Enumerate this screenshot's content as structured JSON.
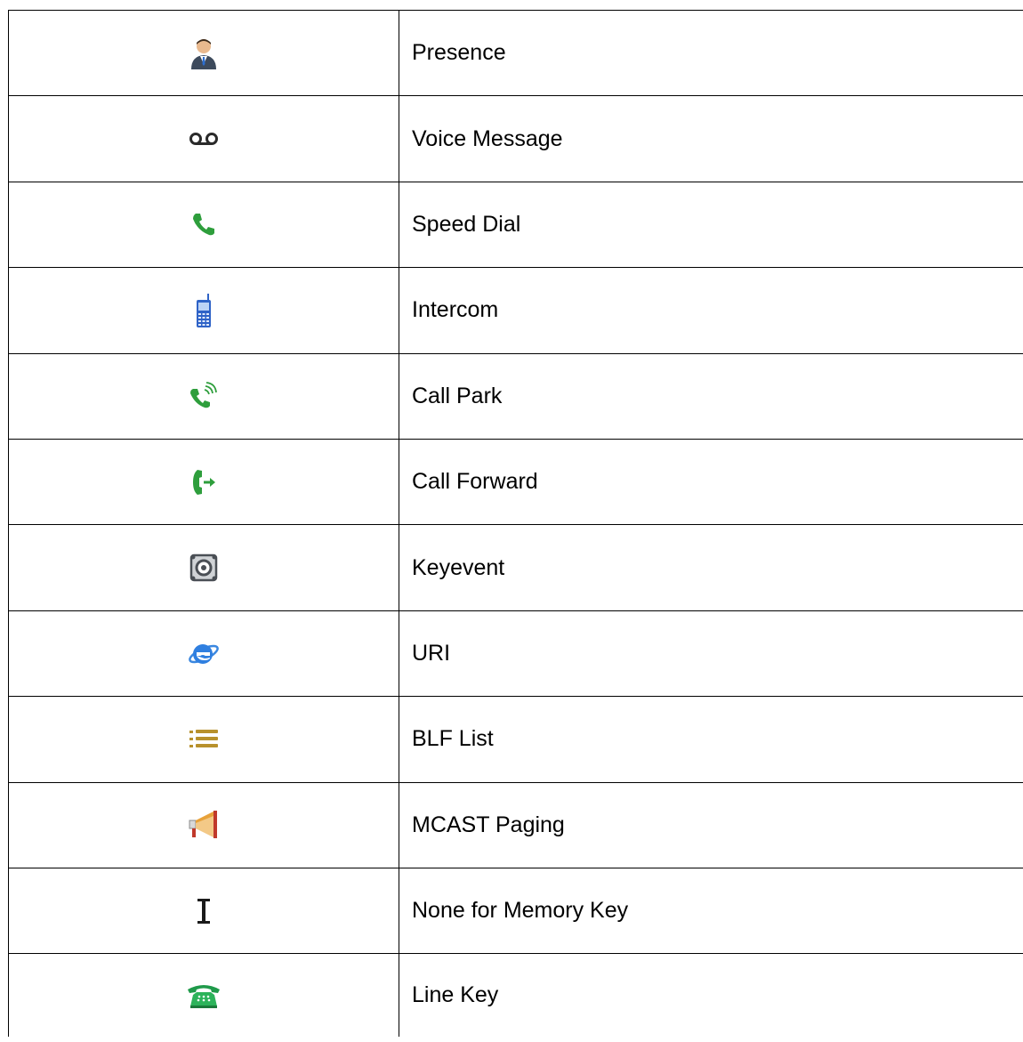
{
  "table": {
    "rows": [
      {
        "icon": "presence-icon",
        "label": "Presence"
      },
      {
        "icon": "voicemail-icon",
        "label": "Voice Message"
      },
      {
        "icon": "phone-icon",
        "label": "Speed Dial"
      },
      {
        "icon": "mobile-phone-icon",
        "label": "Intercom"
      },
      {
        "icon": "ringing-phone-icon",
        "label": "Call Park"
      },
      {
        "icon": "call-forward-icon",
        "label": "Call Forward"
      },
      {
        "icon": "keyevent-icon",
        "label": "Keyevent"
      },
      {
        "icon": "browser-e-icon",
        "label": "URI"
      },
      {
        "icon": "list-icon",
        "label": "BLF List"
      },
      {
        "icon": "megaphone-icon",
        "label": "MCAST Paging"
      },
      {
        "icon": "text-cursor-icon",
        "label": "None for Memory Key"
      },
      {
        "icon": "desk-phone-icon",
        "label": "Line Key"
      }
    ]
  },
  "colors": {
    "phone_green": "#2e9e3c",
    "intercom_blue": "#2f63c7",
    "list_gold": "#b8912c",
    "megaphone_orange": "#e8a23a",
    "border": "#000000"
  }
}
